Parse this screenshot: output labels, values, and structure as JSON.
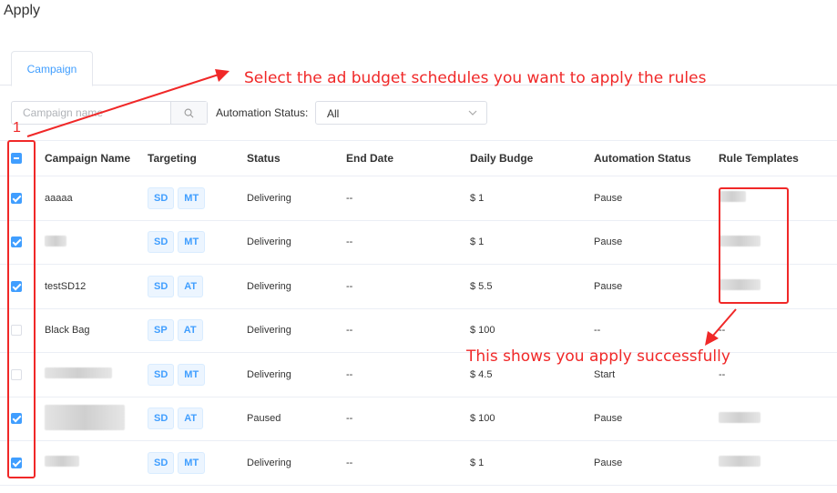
{
  "page": {
    "title": "Apply"
  },
  "tabs": [
    {
      "label": "Campaign",
      "active": true
    }
  ],
  "filters": {
    "search_placeholder": "Campaign name",
    "automation_label": "Automation Status:",
    "automation_value": "All"
  },
  "table": {
    "columns": [
      "Campaign Name",
      "Targeting",
      "Status",
      "End Date",
      "Daily Budge",
      "Automation Status",
      "Rule Templates"
    ],
    "header_checkbox": "indeterminate",
    "rows": [
      {
        "checked": true,
        "name": "aaaaa",
        "name_blurred": false,
        "targeting": [
          "SD",
          "MT"
        ],
        "status": "Delivering",
        "end_date": "--",
        "daily_budget": "$ 1",
        "automation_status": "Pause",
        "rule_template": "",
        "rule_blurred": true
      },
      {
        "checked": true,
        "name": "",
        "name_blurred": true,
        "targeting": [
          "SD",
          "MT"
        ],
        "status": "Delivering",
        "end_date": "--",
        "daily_budget": "$ 1",
        "automation_status": "Pause",
        "rule_template": "",
        "rule_blurred": true
      },
      {
        "checked": true,
        "name": "testSD12",
        "name_blurred": false,
        "targeting": [
          "SD",
          "AT"
        ],
        "status": "Delivering",
        "end_date": "--",
        "daily_budget": "$ 5.5",
        "automation_status": "Pause",
        "rule_template": "",
        "rule_blurred": true
      },
      {
        "checked": false,
        "name": "Black Bag",
        "name_blurred": false,
        "targeting": [
          "SP",
          "AT"
        ],
        "status": "Delivering",
        "end_date": "--",
        "daily_budget": "$ 100",
        "automation_status": "--",
        "rule_template": "--",
        "rule_blurred": false
      },
      {
        "checked": false,
        "name": "",
        "name_blurred": true,
        "targeting": [
          "SD",
          "MT"
        ],
        "status": "Delivering",
        "end_date": "--",
        "daily_budget": "$ 4.5",
        "automation_status": "Start",
        "rule_template": "--",
        "rule_blurred": false
      },
      {
        "checked": true,
        "name": "",
        "name_blurred": true,
        "targeting": [
          "SD",
          "AT"
        ],
        "status": "Paused",
        "end_date": "--",
        "daily_budget": "$ 100",
        "automation_status": "Pause",
        "rule_template": "",
        "rule_blurred": true
      },
      {
        "checked": true,
        "name": "",
        "name_blurred": true,
        "targeting": [
          "SD",
          "MT"
        ],
        "status": "Delivering",
        "end_date": "--",
        "daily_budget": "$ 1",
        "automation_status": "Pause",
        "rule_template": "",
        "rule_blurred": true
      }
    ]
  },
  "annotations": {
    "select_text": "Select the ad budget schedules you want to apply the rules",
    "success_text": "This shows you apply successfully",
    "number": "1",
    "color": "#f02828"
  },
  "colors": {
    "primary": "#409eff",
    "tag_bg": "#ecf5ff",
    "border": "#ebeef5"
  }
}
